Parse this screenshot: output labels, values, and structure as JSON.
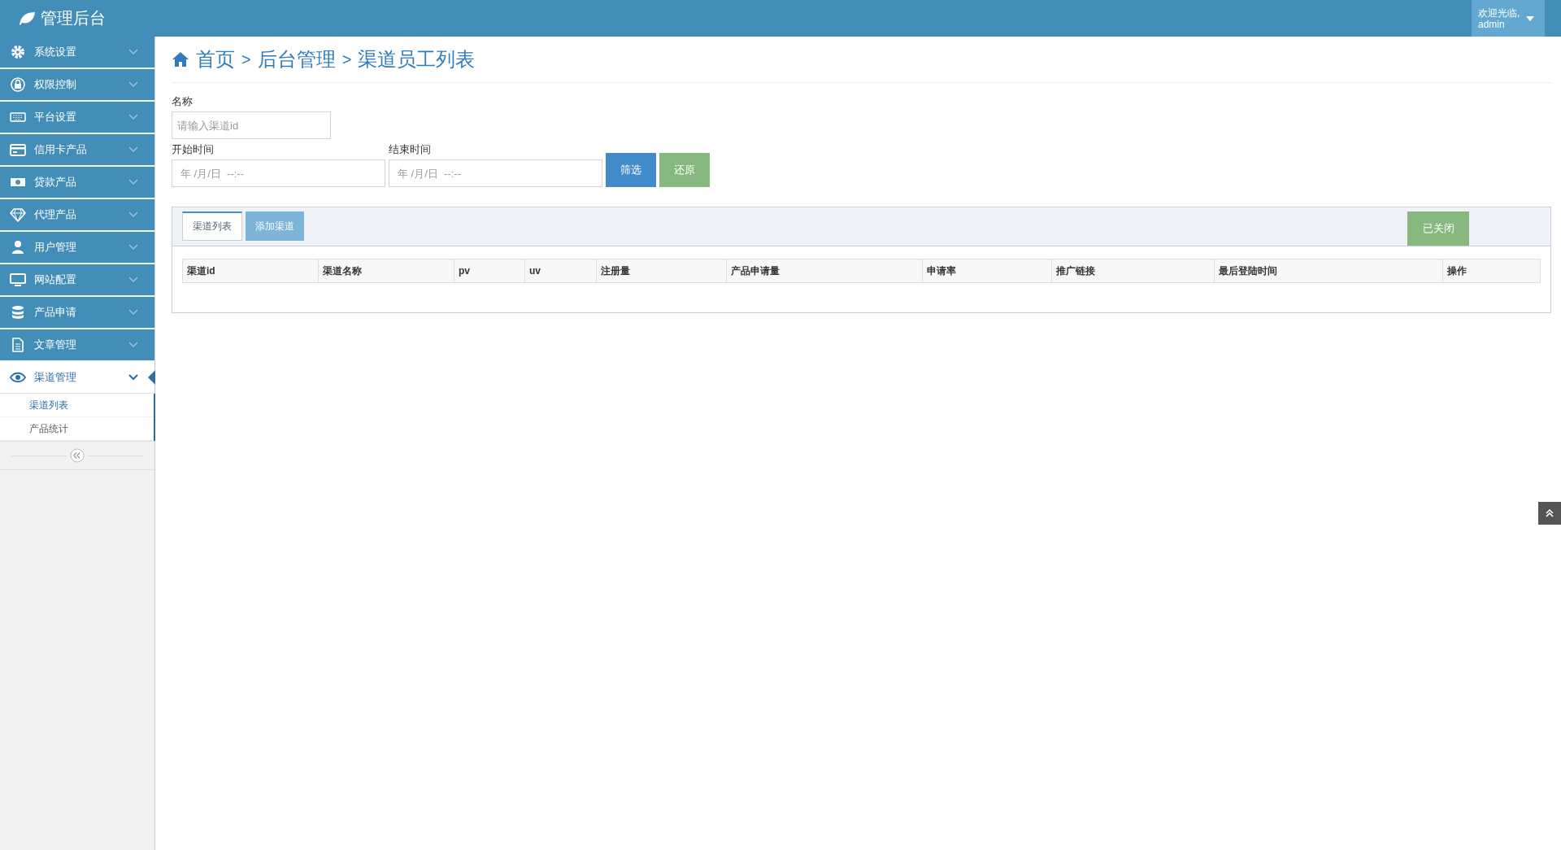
{
  "header": {
    "title": "管理后台",
    "user": {
      "greeting": "欢迎光临,",
      "name": "admin"
    }
  },
  "sidebar": {
    "items": [
      {
        "label": "系统设置",
        "selected": false,
        "expanded": false
      },
      {
        "label": "权限控制",
        "selected": false,
        "expanded": false
      },
      {
        "label": "平台设置",
        "selected": false,
        "expanded": false
      },
      {
        "label": "信用卡产品",
        "selected": false,
        "expanded": false
      },
      {
        "label": "贷款产品",
        "selected": false,
        "expanded": false
      },
      {
        "label": "代理产品",
        "selected": false,
        "expanded": false
      },
      {
        "label": "用户管理",
        "selected": false,
        "expanded": false
      },
      {
        "label": "网站配置",
        "selected": false,
        "expanded": false
      },
      {
        "label": "产品申请",
        "selected": false,
        "expanded": false
      },
      {
        "label": "文章管理",
        "selected": false,
        "expanded": false
      },
      {
        "label": "渠道管理",
        "selected": true,
        "expanded": true,
        "children": [
          {
            "label": "渠道列表",
            "selected": true
          },
          {
            "label": "产品统计",
            "selected": false
          }
        ]
      }
    ]
  },
  "breadcrumb": {
    "separator": ">",
    "items": [
      "首页",
      "后台管理",
      "渠道员工列表"
    ]
  },
  "filters": {
    "name": {
      "label": "名称",
      "placeholder": "请输入渠道id"
    },
    "start": {
      "label": "开始时间",
      "placeholder": "年 /月/日  --:--"
    },
    "end": {
      "label": "结束时间",
      "placeholder": "年 /月/日  --:--"
    },
    "buttons": [
      "筛选",
      "还原"
    ]
  },
  "tabs": [
    {
      "label": "渠道列表",
      "selected": true
    },
    {
      "label": "添加渠道",
      "selected": false
    }
  ],
  "status_button": "已关闭",
  "table": {
    "columns": [
      "渠道id",
      "渠道名称",
      "pv",
      "uv",
      "注册量",
      "产品申请量",
      "申请率",
      "推广链接",
      "最后登陆时间",
      "操作"
    ]
  }
}
